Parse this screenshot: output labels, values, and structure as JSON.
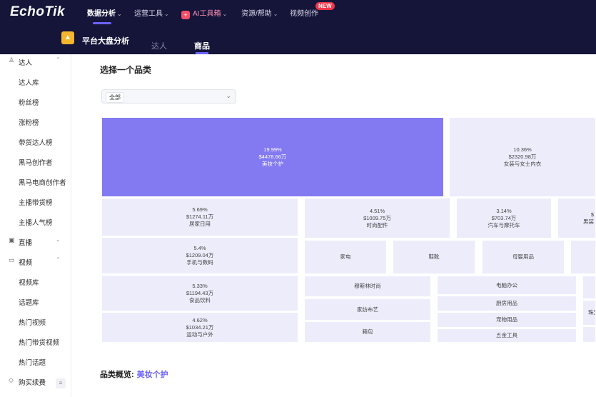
{
  "app": {
    "logo": "EchoTik"
  },
  "nav": {
    "items": [
      {
        "label": "数据分析",
        "chevron": "⌄"
      },
      {
        "label": "运营工具",
        "chevron": "⌄"
      },
      {
        "label": "AI工具箱",
        "chevron": "⌄",
        "badge_icon": "+"
      },
      {
        "label": "资源/帮助",
        "chevron": "⌄"
      },
      {
        "label": "视频创作"
      }
    ],
    "new_badge": "NEW"
  },
  "subheader": {
    "title": "平台大盘分析",
    "tabs": [
      {
        "label": "达人"
      },
      {
        "label": "商品"
      }
    ]
  },
  "sidebar": {
    "groups": [
      {
        "label": "达人",
        "icon": "user-icon",
        "chevron": "⌃"
      },
      {
        "label": "直播",
        "icon": "live-icon",
        "chevron": "⌄"
      },
      {
        "label": "视频",
        "icon": "video-icon",
        "chevron": "⌃"
      },
      {
        "label": "购买续费",
        "icon": "diamond-icon"
      }
    ],
    "items": [
      {
        "label": "达人库"
      },
      {
        "label": "粉丝榜"
      },
      {
        "label": "涨粉榜"
      },
      {
        "label": "带货达人榜"
      },
      {
        "label": "黑马创作者"
      },
      {
        "label": "黑马电商创作者"
      },
      {
        "label": "主播带货榜"
      },
      {
        "label": "主播人气榜"
      },
      {
        "label": "视频库"
      },
      {
        "label": "话题库"
      },
      {
        "label": "热门视频"
      },
      {
        "label": "热门带货视频"
      },
      {
        "label": "热门话题"
      }
    ],
    "menu_icon": "≡"
  },
  "main": {
    "section_title": "选择一个品类",
    "select": {
      "value": "全部",
      "chevron": "⌄"
    },
    "overview_label": "品类概览:",
    "overview_value": "美妆个护"
  },
  "treemap": {
    "tiles": [
      {
        "pct": "19.99%",
        "amount": "$4478.66万",
        "name": "美妆个护",
        "selected": true
      },
      {
        "pct": "10.36%",
        "amount": "$2320.98万",
        "name": "女装与女士内衣"
      },
      {
        "pct": "5.69%",
        "amount": "$1274.11万",
        "name": "居家日用"
      },
      {
        "pct": "4.51%",
        "amount": "$1009.75万",
        "name": "时尚配件"
      },
      {
        "pct": "3.14%",
        "amount": "$703.74万",
        "name": "汽车与摩托车"
      },
      {
        "pct": "$",
        "amount": "",
        "name": "男装"
      },
      {
        "pct": "5.4%",
        "amount": "$1209.04万",
        "name": "手机与数码"
      },
      {
        "name": "家电"
      },
      {
        "name": "鞋靴"
      },
      {
        "name": "母婴用品"
      },
      {
        "pct": "5.33%",
        "amount": "$1194.43万",
        "name": "食品饮料"
      },
      {
        "name": "穆斯林时尚"
      },
      {
        "name": "电脑办公"
      },
      {
        "name": "家纺布艺"
      },
      {
        "name": "厨房用品"
      },
      {
        "name": "珠宝"
      },
      {
        "pct": "4.62%",
        "amount": "$1034.21万",
        "name": "运动与户外"
      },
      {
        "name": "箱包"
      },
      {
        "name": "宠物用品"
      },
      {
        "name": "五金工具"
      }
    ]
  }
}
